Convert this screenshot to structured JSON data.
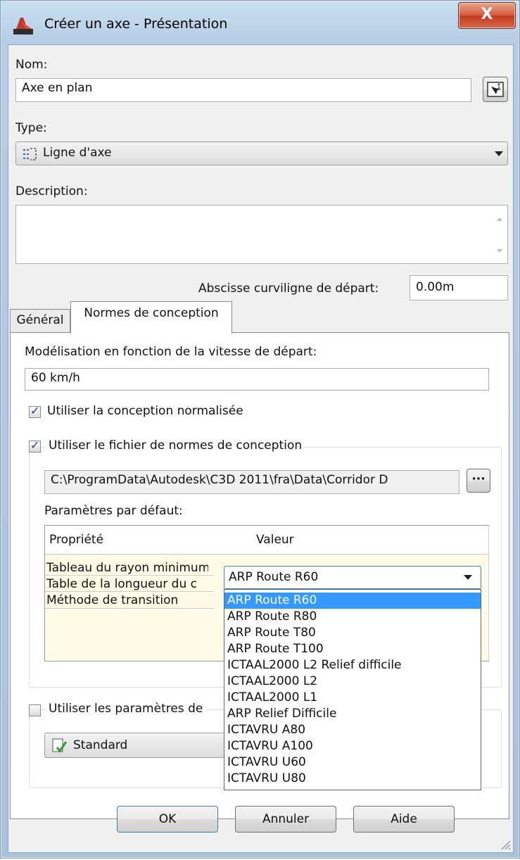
{
  "window": {
    "title": "Créer un axe - Présentation",
    "close_glyph": "X"
  },
  "name_section": {
    "label": "Nom:",
    "value": "Axe en plan"
  },
  "type_section": {
    "label": "Type:",
    "value": "Ligne d'axe"
  },
  "description_section": {
    "label": "Description:",
    "value": ""
  },
  "station": {
    "label": "Abscisse curviligne de départ:",
    "value": "0.00m"
  },
  "tabs": [
    {
      "label": "Général"
    },
    {
      "label": "Normes de conception"
    }
  ],
  "design": {
    "speed_label": "Modélisation en fonction de la vitesse de départ:",
    "speed_value": "60 km/h",
    "use_design_criteria": {
      "label": "Utiliser la conception normalisée",
      "checked": true
    },
    "use_criteria_file": {
      "label": "Utiliser le fichier de normes de conception",
      "checked": true
    },
    "file_path": "C:\\ProgramData\\Autodesk\\C3D 2011\\fra\\Data\\Corridor D",
    "browse_label": "···",
    "defaults_label": "Paramètres par défaut:",
    "grid": {
      "headers": [
        "Propriété",
        "Valeur"
      ],
      "rows": [
        "Tableau du rayon minimum",
        "Table de la longueur du c",
        "Méthode de transition"
      ]
    },
    "combo_value": "ARP Route R60",
    "options": [
      "ARP Route R60",
      "ARP Route R80",
      "ARP Route T80",
      "ARP Route T100",
      "ICTAAL2000 L2 Relief difficile",
      "ICTAAL2000 L2",
      "ICTAAL2000 L1",
      "ARP Relief Difficile",
      "ICTAVRU A80",
      "ICTAVRU A100",
      "ICTAVRU U60",
      "ICTAVRU U80"
    ],
    "selected_option_index": 0,
    "use_check_set": {
      "label": "Utiliser les paramètres de",
      "checked": false
    },
    "check_set_value": "Standard"
  },
  "buttons": {
    "ok": "OK",
    "cancel": "Annuler",
    "help": "Aide"
  }
}
